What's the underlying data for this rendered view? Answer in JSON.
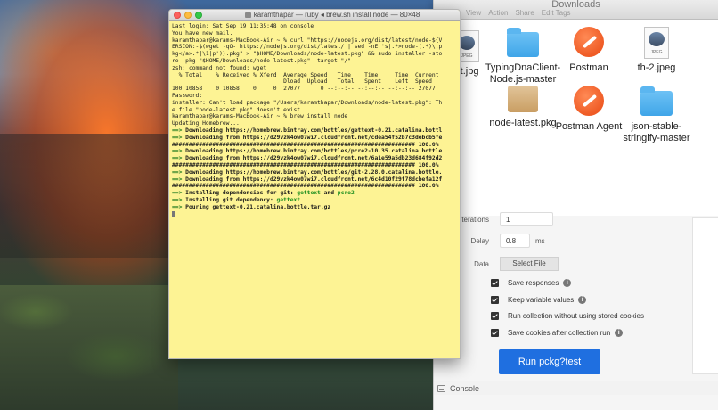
{
  "finder": {
    "title": "Downloads",
    "actions": [
      "View",
      "Action",
      "Share",
      "Edit Tags"
    ],
    "items": [
      {
        "label_lines": [
          "pt.jpg"
        ],
        "icon": "jpeg-icon"
      },
      {
        "label_lines": [
          "TypingDnaClient-",
          "Node.js-master"
        ],
        "icon": "folder-icon"
      },
      {
        "label_lines": [
          "Postman"
        ],
        "icon": "postman-app-icon"
      },
      {
        "label_lines": [
          "th-2.jpeg"
        ],
        "icon": "jpeg-icon"
      },
      {
        "label_lines": [
          "node-latest.pkg"
        ],
        "icon": "package-icon"
      },
      {
        "label_lines": [
          "Postman Agent"
        ],
        "icon": "postman-app-icon"
      },
      {
        "label_lines": [
          "json-stable-",
          "stringify-master"
        ],
        "icon": "folder-icon"
      }
    ],
    "jpeg_tag": "JPEG"
  },
  "runner": {
    "iterations_label": "Iterations",
    "iterations_value": "1",
    "delay_label": "Delay",
    "delay_value": "0.8",
    "delay_unit": "ms",
    "data_label": "Data",
    "select_file_label": "Select File",
    "options": [
      {
        "label": "Save responses",
        "checked": true,
        "info": true
      },
      {
        "label": "Keep variable values",
        "checked": true,
        "info": true
      },
      {
        "label": "Run collection without using stored cookies",
        "checked": true,
        "info": false
      },
      {
        "label": "Save cookies after collection run",
        "checked": true,
        "info": true
      }
    ],
    "run_button_label": "Run pckg?test",
    "console_label": "Console"
  },
  "terminal": {
    "title": "karamthapar — ruby ◂ brew.sh install node — 80×48",
    "lines": [
      {
        "t": "Last login: Sat Sep 19 11:35:48 on console"
      },
      {
        "t": "You have new mail."
      },
      {
        "t": "karamthapar@karams-MacBook-Air ~ % curl \"https://nodejs.org/dist/latest/node-${V"
      },
      {
        "t": "ERSION:-$(wget -qO- https://nodejs.org/dist/latest/ | sed -nE 's|.*>node-(.*)\\.p"
      },
      {
        "t": "kg</a>.*|\\1|p')}.pkg\" > \"$HOME/Downloads/node-latest.pkg\" && sudo installer -sto"
      },
      {
        "t": "re -pkg \"$HOME/Downloads/node-latest.pkg\" -target \"/\""
      },
      {
        "t": "zsh: command not found: wget"
      },
      {
        "t": "  % Total    % Received % Xferd  Average Speed   Time    Time     Time  Current"
      },
      {
        "t": "                                 Dload  Upload   Total   Spent    Left  Speed"
      },
      {
        "t": "100 10858    0 10858    0     0  27077      0 --:--:-- --:--:-- --:--:-- 27077"
      },
      {
        "t": "Password:"
      },
      {
        "t": "installer: Can't load package \"/Users/karamthapar/Downloads/node-latest.pkg\": Th"
      },
      {
        "t": "e file \"node-latest.pkg\" doesn't exist."
      },
      {
        "t": "karamthapar@karams-MacBook-Air ~ % brew install node"
      },
      {
        "t": "Updating Homebrew..."
      },
      {
        "a": "==> ",
        "t": "Downloading https://homebrew.bintray.com/bottles/gettext-0.21.catalina.bottl",
        "bold": true
      },
      {
        "a": "==> ",
        "t": "Downloading from https://d29vzk4ow07wi7.cloudfront.net/cdea54f52b7c3debcb5fe",
        "bold": true
      },
      {
        "t": "######################################################################## 100.0%",
        "bold": true
      },
      {
        "a": "==> ",
        "t": "Downloading https://homebrew.bintray.com/bottles/pcre2-10.35.catalina.bottle",
        "bold": true
      },
      {
        "a": "==> ",
        "t": "Downloading from https://d29vzk4ow07wi7.cloudfront.net/6a1e59a5db23d684f92d2",
        "bold": true
      },
      {
        "t": "######################################################################## 100.0%",
        "bold": true
      },
      {
        "a": "==> ",
        "t": "Downloading https://homebrew.bintray.com/bottles/git-2.28.0.catalina.bottle.",
        "bold": true
      },
      {
        "a": "==> ",
        "t": "Downloading from https://d29vzk4ow07wi7.cloudfront.net/6c4d10f29f78dcbefa12f",
        "bold": true
      },
      {
        "t": "######################################################################## 100.0%",
        "bold": true
      },
      {
        "a": "==> ",
        "t": "Installing dependencies for git: ",
        "g1": "gettext",
        "t2": " and ",
        "g2": "pcre2",
        "bold": true
      },
      {
        "a": "==> ",
        "t": "Installing git dependency: ",
        "g1": "gettext",
        "bold": true
      },
      {
        "a": "==> ",
        "t": "Pouring gettext-0.21.catalina.bottle.tar.gz",
        "bold": true
      }
    ]
  }
}
